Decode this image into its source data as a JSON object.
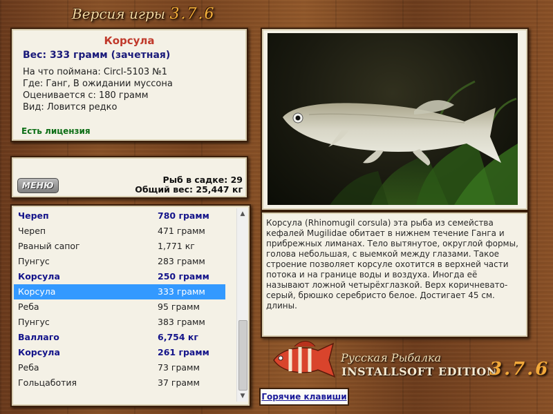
{
  "header": {
    "title": "Версия игры",
    "version": "3.7.6"
  },
  "fish_info": {
    "name": "Корсула",
    "weight": "Вес: 333 грамм (зачетная)",
    "caught_with": "На что поймана: Circl-5103 №1",
    "location": "Где: Ганг, В ожидании муссона",
    "rated_from": "Оценивается с: 180 грамм",
    "type": "Вид: Ловится редко",
    "license": "Есть лицензия"
  },
  "keepnet": {
    "menu_label": "МЕНЮ",
    "fish_count": "Рыб в садке: 29",
    "total_weight": "Общий вес: 25,447 кг"
  },
  "catch_list": [
    {
      "name": "Череп",
      "weight": "780 грамм",
      "bold": true,
      "selected": false
    },
    {
      "name": "Череп",
      "weight": "471 грамм",
      "bold": false,
      "selected": false
    },
    {
      "name": "Рваный сапог",
      "weight": "1,771 кг",
      "bold": false,
      "selected": false
    },
    {
      "name": "Пунгус",
      "weight": "283 грамм",
      "bold": false,
      "selected": false
    },
    {
      "name": "Корсула",
      "weight": "250 грамм",
      "bold": true,
      "selected": false
    },
    {
      "name": "Корсула",
      "weight": "333 грамм",
      "bold": false,
      "selected": true
    },
    {
      "name": "Реба",
      "weight": "95 грамм",
      "bold": false,
      "selected": false
    },
    {
      "name": "Пунгус",
      "weight": "383 грамм",
      "bold": false,
      "selected": false
    },
    {
      "name": "Валлаго",
      "weight": "6,754 кг",
      "bold": true,
      "selected": false
    },
    {
      "name": "Корсула",
      "weight": "261 грамм",
      "bold": true,
      "selected": false
    },
    {
      "name": "Реба",
      "weight": "73 грамм",
      "bold": false,
      "selected": false
    },
    {
      "name": "Гольцаботия",
      "weight": "37 грамм",
      "bold": false,
      "selected": false
    }
  ],
  "description": "Корсула (Rhinomugil corsula) эта рыба из семейства кефалей Mugilidae обитает в нижнем течение Ганга и прибрежных лиманах. Тело вытянутое, округлой формы, голова небольшая, с выемкой между глазами. Такое строение позволяет корсуле охотится в верхней части потока и на границе воды и воздуха. Иногда её называют ложной четырёхглазкой. Верх коричневато-серый, брюшко серебристо белое. Достигает 45 см. длины.",
  "brand": {
    "line1": "Русская Рыбалка",
    "line2": "INSTALLSOFT EDITION",
    "version": "3.7.6"
  },
  "hotkeys_label": "Горячие клавиши",
  "colors": {
    "selection": "#3399ff",
    "highlight_text": "#14148a",
    "fish_name": "#c0392b",
    "license": "#0c6e15"
  },
  "icons": {
    "menu": "menu-button",
    "fish_photo": "fish-photo",
    "logo": "fish-logo-icon"
  }
}
